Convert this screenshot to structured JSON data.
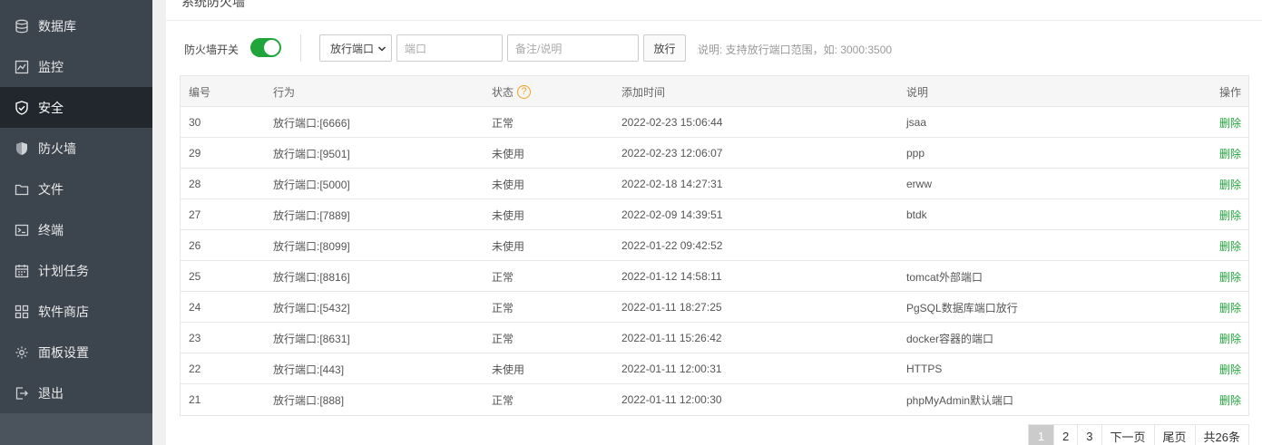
{
  "sidebar": {
    "items": [
      {
        "label": "数据库",
        "icon": "database-icon"
      },
      {
        "label": "监控",
        "icon": "monitor-icon"
      },
      {
        "label": "安全",
        "icon": "shield-check-icon",
        "active": true
      },
      {
        "label": "防火墙",
        "icon": "shield-icon"
      },
      {
        "label": "文件",
        "icon": "folder-icon"
      },
      {
        "label": "终端",
        "icon": "terminal-icon"
      },
      {
        "label": "计划任务",
        "icon": "calendar-icon"
      },
      {
        "label": "软件商店",
        "icon": "grid-icon"
      },
      {
        "label": "面板设置",
        "icon": "gear-icon"
      },
      {
        "label": "退出",
        "icon": "logout-icon"
      }
    ]
  },
  "panel": {
    "title": "系统防火墙"
  },
  "toolbar": {
    "firewall_switch_label": "防火墙开关",
    "firewall_enabled": true,
    "rule_type_selected": "放行端口",
    "port_placeholder": "端口",
    "note_placeholder": "备注/说明",
    "open_button": "放行",
    "hint": "说明: 支持放行端口范围，如: 3000:3500"
  },
  "table": {
    "headers": {
      "id": "编号",
      "action": "行为",
      "status": "状态",
      "status_help": "?",
      "time": "添加时间",
      "note": "说明",
      "op": "操作"
    },
    "rows": [
      {
        "id": "30",
        "action": "放行端口:[6666]",
        "status": "正常",
        "time": "2022-02-23 15:06:44",
        "note": "jsaa",
        "op": "删除"
      },
      {
        "id": "29",
        "action": "放行端口:[9501]",
        "status": "未使用",
        "time": "2022-02-23 12:06:07",
        "note": "ppp",
        "op": "删除"
      },
      {
        "id": "28",
        "action": "放行端口:[5000]",
        "status": "未使用",
        "time": "2022-02-18 14:27:31",
        "note": "erww",
        "op": "删除"
      },
      {
        "id": "27",
        "action": "放行端口:[7889]",
        "status": "未使用",
        "time": "2022-02-09 14:39:51",
        "note": "btdk",
        "op": "删除"
      },
      {
        "id": "26",
        "action": "放行端口:[8099]",
        "status": "未使用",
        "time": "2022-01-22 09:42:52",
        "note": "",
        "op": "删除"
      },
      {
        "id": "25",
        "action": "放行端口:[8816]",
        "status": "正常",
        "time": "2022-01-12 14:58:11",
        "note": "tomcat外部端口",
        "op": "删除"
      },
      {
        "id": "24",
        "action": "放行端口:[5432]",
        "status": "正常",
        "time": "2022-01-11 18:27:25",
        "note": "PgSQL数据库端口放行",
        "op": "删除"
      },
      {
        "id": "23",
        "action": "放行端口:[8631]",
        "status": "正常",
        "time": "2022-01-11 15:26:42",
        "note": "docker容器的端口",
        "op": "删除"
      },
      {
        "id": "22",
        "action": "放行端口:[443]",
        "status": "未使用",
        "time": "2022-01-11 12:00:31",
        "note": "HTTPS",
        "op": "删除"
      },
      {
        "id": "21",
        "action": "放行端口:[888]",
        "status": "正常",
        "time": "2022-01-11 12:00:30",
        "note": "phpMyAdmin默认端口",
        "op": "删除"
      }
    ]
  },
  "pager": {
    "pages": [
      "1",
      "2",
      "3"
    ],
    "current": "1",
    "next": "下一页",
    "last": "尾页",
    "total": "共26条"
  },
  "colors": {
    "sidebar_bg": "#3c444d",
    "sidebar_active": "#22272d",
    "accent_green": "#20a53a",
    "help_orange": "#f0a020"
  }
}
